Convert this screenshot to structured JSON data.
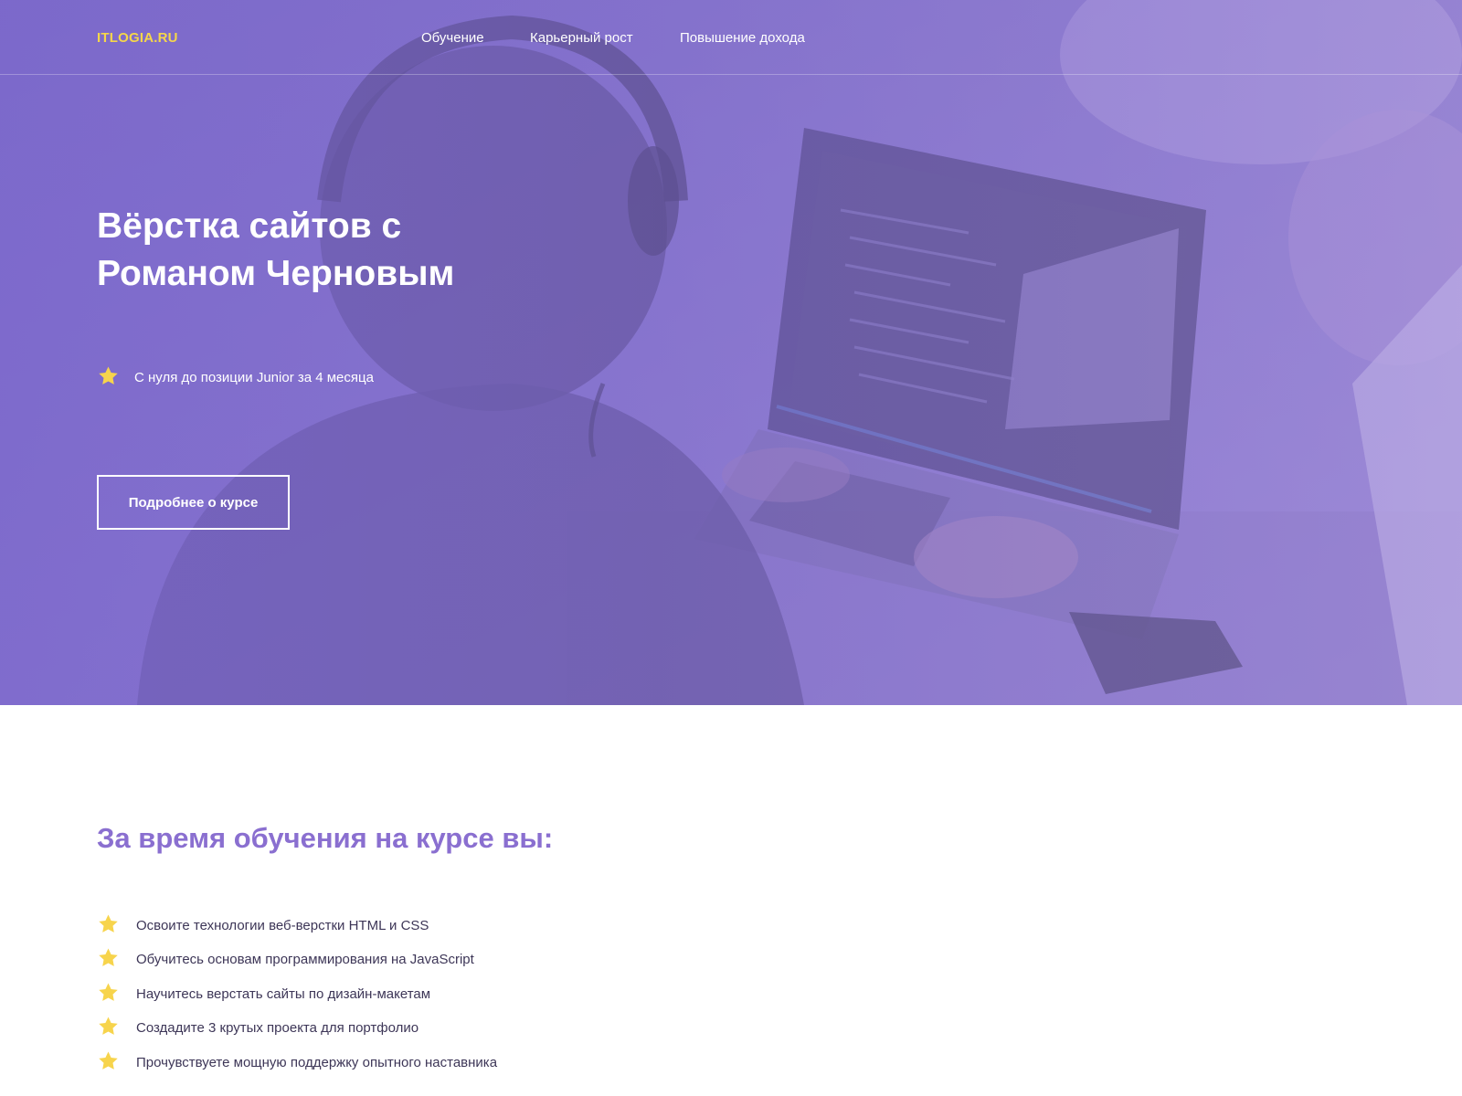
{
  "header": {
    "logo": "ITLOGIA.RU",
    "nav": [
      {
        "label": "Обучение"
      },
      {
        "label": "Карьерный рост"
      },
      {
        "label": "Повышение дохода"
      }
    ]
  },
  "hero": {
    "title_line1": "Вёрстка сайтов с",
    "title_line2": "Романом Черновым",
    "feature": "С нуля до позиции Junior за 4 месяца",
    "cta_label": "Подробнее о курсе"
  },
  "benefits": {
    "title": "За время обучения на курсе вы:",
    "items": [
      {
        "text": "Освоите технологии веб-верстки HTML и CSS"
      },
      {
        "text": "Обучитесь основам программирования на JavaScript"
      },
      {
        "text": "Научитесь верстать сайты по дизайн-макетам"
      },
      {
        "text": "Создадите 3 крутых проекта для портфолио"
      },
      {
        "text": "Прочувствуете мощную поддержку опытного наставника"
      }
    ]
  },
  "colors": {
    "accent": "#8a6fd0",
    "logo": "#f5d64a",
    "star": "#f7d44c",
    "hero_overlay": "#7c68ce"
  },
  "icons": {
    "list_bullet": "star-icon"
  }
}
